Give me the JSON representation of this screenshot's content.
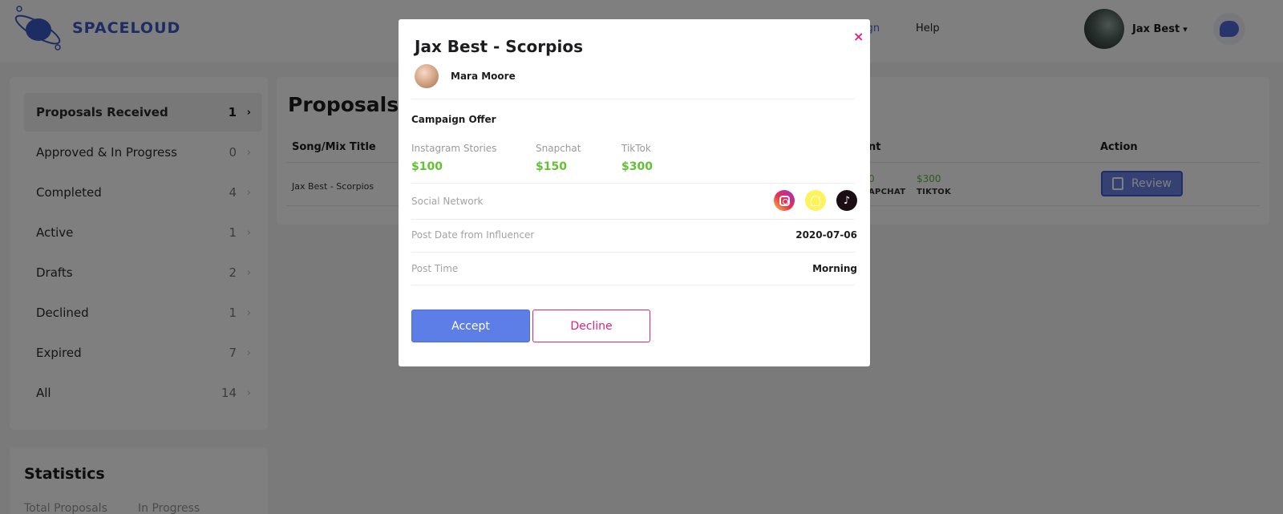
{
  "brand": {
    "name": "SPACELOUD"
  },
  "nav": {
    "campaign_partial": "aign",
    "help": "Help"
  },
  "user": {
    "name": "Jax Best"
  },
  "sidebar": {
    "items": [
      {
        "label": "Proposals Received",
        "count": "1",
        "active": true
      },
      {
        "label": "Approved & In Progress",
        "count": "0"
      },
      {
        "label": "Completed",
        "count": "4"
      },
      {
        "label": "Active",
        "count": "1"
      },
      {
        "label": "Drafts",
        "count": "2"
      },
      {
        "label": "Declined",
        "count": "1"
      },
      {
        "label": "Expired",
        "count": "7"
      },
      {
        "label": "All",
        "count": "14"
      }
    ]
  },
  "stats": {
    "title": "Statistics",
    "total_label": "Total Proposals",
    "progress_label": "In Progress"
  },
  "main": {
    "title": "Proposals R",
    "col_song": "Song/Mix Title",
    "col_amount_partial": "nt",
    "col_action": "Action",
    "row": {
      "song": "Jax Best - Scorpios",
      "amount_1": "0",
      "label_1": "APCHAT",
      "amount_2": "$300",
      "label_2": "TIKTOK",
      "action": "Review"
    }
  },
  "modal": {
    "title": "Jax Best - Scorpios",
    "influencer": "Mara Moore",
    "offer_heading": "Campaign Offer",
    "platforms": [
      {
        "name": "Instagram Stories",
        "price": "$100"
      },
      {
        "name": "Snapchat",
        "price": "$150"
      },
      {
        "name": "TikTok",
        "price": "$300"
      }
    ],
    "social_label": "Social Network",
    "social_icons": [
      "instagram-icon",
      "snapchat-icon",
      "tiktok-icon"
    ],
    "post_date_label": "Post Date from Influencer",
    "post_date": "2020-07-06",
    "post_time_label": "Post Time",
    "post_time": "Morning",
    "accept": "Accept",
    "decline": "Decline",
    "close": "×"
  },
  "colors": {
    "accent": "#5d7de7",
    "price_green": "#62c233",
    "decline_pink": "#e0237d",
    "brand_blue": "#3a5bc7"
  }
}
